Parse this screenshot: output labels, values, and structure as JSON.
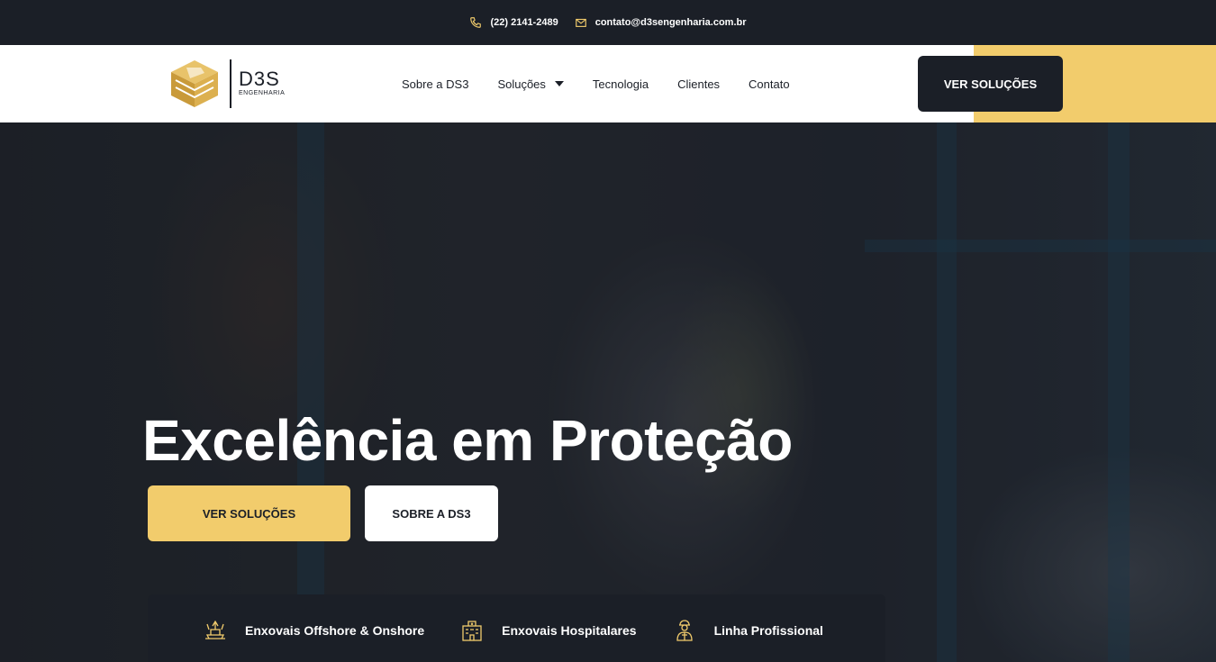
{
  "topbar": {
    "phone": "(22) 2141-2489",
    "email": "contato@d3sengenharia.com.br"
  },
  "logo": {
    "name": "D3S",
    "tagline": "ENGENHARIA"
  },
  "nav": {
    "items": [
      "Sobre a DS3",
      "Soluções",
      "Tecnologia",
      "Clientes",
      "Contato"
    ]
  },
  "header": {
    "cta_label": "VER SOLUÇÕES"
  },
  "hero": {
    "title": "Excelência em Proteção",
    "primary_button": "VER SOLUÇÕES",
    "secondary_button": "SOBRE A DS3"
  },
  "features": [
    {
      "label": "Enxovais Offshore & Onshore",
      "icon": "oil-rig-icon"
    },
    {
      "label": "Enxovais Hospitalares",
      "icon": "hospital-icon"
    },
    {
      "label": "Linha Profissional",
      "icon": "worker-icon"
    }
  ],
  "colors": {
    "accent": "#f2cc6c",
    "dark": "#1b1f27",
    "white": "#ffffff"
  }
}
